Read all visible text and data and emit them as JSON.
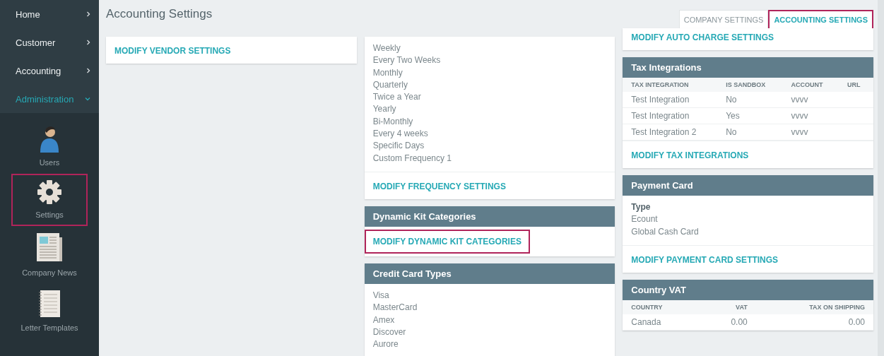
{
  "sidebar": {
    "nav": [
      {
        "label": "Home",
        "selected": false
      },
      {
        "label": "Customer",
        "selected": false
      },
      {
        "label": "Accounting",
        "selected": false
      },
      {
        "label": "Administration",
        "selected": true
      }
    ],
    "apps": [
      {
        "label": "Users",
        "kind": "users",
        "highlighted": false
      },
      {
        "label": "Settings",
        "kind": "settings",
        "highlighted": true
      },
      {
        "label": "Company News",
        "kind": "news",
        "highlighted": false
      },
      {
        "label": "Letter Templates",
        "kind": "templates",
        "highlighted": false
      }
    ]
  },
  "header": {
    "title": "Accounting Settings",
    "tabs": [
      {
        "label": "COMPANY SETTINGS",
        "selected": false,
        "highlighted": false
      },
      {
        "label": "ACCOUNTING SETTINGS",
        "selected": true,
        "highlighted": true
      }
    ]
  },
  "columns": [
    {
      "cards": [
        {
          "kind": "link",
          "link": "MODIFY VENDOR SETTINGS",
          "highlighted": false
        }
      ]
    },
    {
      "cards": [
        {
          "kind": "list",
          "items": [
            "Weekly",
            "Every Two Weeks",
            "Monthly",
            "Quarterly",
            "Twice a Year",
            "Yearly",
            "Bi-Monthly",
            "Every 4 weeks",
            "Specific Days",
            "Custom Frequency 1"
          ],
          "link": "MODIFY FREQUENCY SETTINGS",
          "highlighted": false
        },
        {
          "kind": "link",
          "title": "Dynamic Kit Categories",
          "link": "MODIFY DYNAMIC KIT CATEGORIES",
          "highlighted": true
        },
        {
          "kind": "list",
          "title": "Credit Card Types",
          "items": [
            "Visa",
            "MasterCard",
            "Amex",
            "Discover",
            "Aurore"
          ]
        }
      ]
    },
    {
      "cards": [
        {
          "kind": "link",
          "link": "MODIFY AUTO CHARGE SETTINGS",
          "highlighted": false
        },
        {
          "kind": "table",
          "title": "Tax Integrations",
          "columns": [
            "TAX INTEGRATION",
            "IS SANDBOX",
            "ACCOUNT",
            "URL"
          ],
          "rows": [
            [
              "Test Integration",
              "No",
              "vvvv",
              ""
            ],
            [
              "Test Integration",
              "Yes",
              "vvvv",
              ""
            ],
            [
              "Test Integration 2",
              "No",
              "vvvv",
              ""
            ]
          ],
          "link": "MODIFY TAX INTEGRATIONS",
          "highlighted": false
        },
        {
          "kind": "list",
          "title": "Payment Card",
          "heading": "Type",
          "items": [
            "Ecount",
            "Global Cash Card"
          ],
          "link": "MODIFY PAYMENT CARD SETTINGS",
          "highlighted": false
        },
        {
          "kind": "numeric-table",
          "title": "Country VAT",
          "columns": [
            "COUNTRY",
            "VAT",
            "TAX ON SHIPPING"
          ],
          "rows": [
            [
              "Canada",
              "0.00",
              "0.00"
            ]
          ]
        }
      ]
    }
  ]
}
